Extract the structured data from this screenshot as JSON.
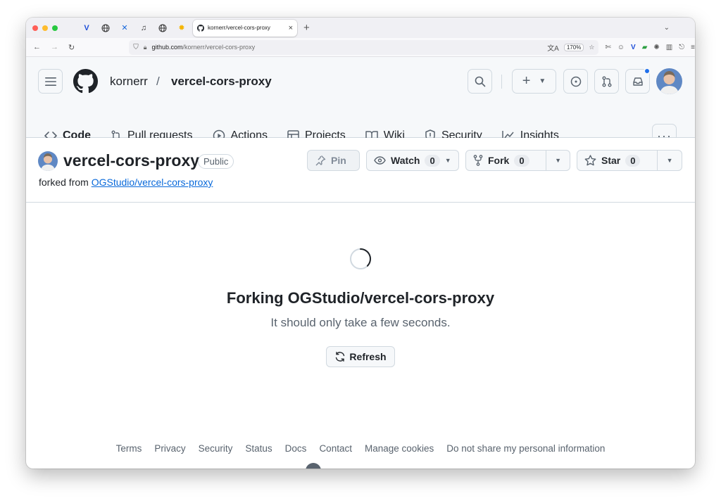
{
  "browser": {
    "tab_title": "kornerr/vercel-cors-proxy",
    "tab_close": "×",
    "new_tab": "+",
    "url_domain": "github.com",
    "url_path": "/kornerr/vercel-cors-proxy",
    "zoom": "170%",
    "traffic_colors": [
      "#ff5f57",
      "#febc2e",
      "#28c840"
    ]
  },
  "header": {
    "owner": "kornerr",
    "separator": "/",
    "repo": "vercel-cors-proxy"
  },
  "tabs": [
    {
      "label": "Code",
      "icon": "code-icon"
    },
    {
      "label": "Pull requests",
      "icon": "pull-request-icon"
    },
    {
      "label": "Actions",
      "icon": "play-icon"
    },
    {
      "label": "Projects",
      "icon": "table-icon"
    },
    {
      "label": "Wiki",
      "icon": "book-icon"
    },
    {
      "label": "Security",
      "icon": "shield-icon"
    },
    {
      "label": "Insights",
      "icon": "graph-icon"
    }
  ],
  "repo_head": {
    "name": "vercel-cors-proxy",
    "visibility": "Public",
    "forked_prefix": "forked from",
    "forked_link": "OGStudio/vercel-cors-proxy",
    "pin": "Pin",
    "watch": "Watch",
    "watch_count": "0",
    "fork": "Fork",
    "fork_count": "0",
    "star": "Star",
    "star_count": "0"
  },
  "main": {
    "title": "Forking OGStudio/vercel-cors-proxy",
    "subtitle": "It should only take a few seconds.",
    "refresh": "Refresh"
  },
  "footer": [
    "Terms",
    "Privacy",
    "Security",
    "Status",
    "Docs",
    "Contact",
    "Manage cookies",
    "Do not share my personal information"
  ],
  "colors": {
    "accent": "#fd8c73",
    "link": "#0969da",
    "notification": "#1f6feb"
  }
}
